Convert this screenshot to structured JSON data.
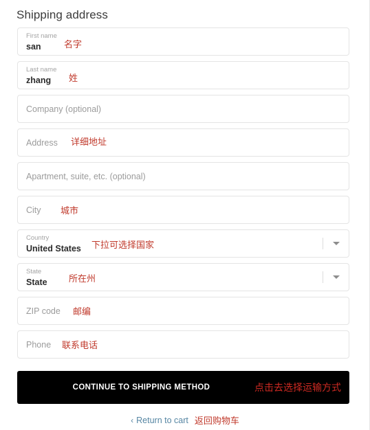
{
  "page": {
    "title": "Shipping address"
  },
  "colors": {
    "annotation_red": "#c0392b",
    "button_bg": "#000000",
    "link_blue": "#5686a3",
    "field_border": "#e4e4e4",
    "placeholder_gray": "#9b9b9b"
  },
  "form": {
    "fields": [
      {
        "name": "first-name",
        "label": "First name",
        "value": "san",
        "placeholder": "First name",
        "filled": true,
        "note": "名字",
        "type": "text"
      },
      {
        "name": "last-name",
        "label": "Last name",
        "value": "zhang",
        "placeholder": "Last name",
        "filled": true,
        "note": "姓",
        "type": "text"
      },
      {
        "name": "company",
        "label": "Company (optional)",
        "value": "",
        "placeholder": "Company (optional)",
        "filled": false,
        "note": "",
        "type": "text"
      },
      {
        "name": "address",
        "label": "Address",
        "value": "",
        "placeholder": "Address",
        "filled": false,
        "note": "详细地址",
        "type": "text"
      },
      {
        "name": "apartment",
        "label": "Apartment, suite, etc. (optional)",
        "value": "",
        "placeholder": "Apartment, suite, etc. (optional)",
        "filled": false,
        "note": "",
        "type": "text"
      },
      {
        "name": "city",
        "label": "City",
        "value": "",
        "placeholder": "City",
        "filled": false,
        "note": "城市",
        "type": "text"
      },
      {
        "name": "country",
        "label": "Country",
        "value": "United States",
        "placeholder": "Country",
        "filled": true,
        "note": "下拉可选择国家",
        "type": "select"
      },
      {
        "name": "state",
        "label": "State",
        "value": "State",
        "placeholder": "State",
        "filled": true,
        "note": "所在州",
        "type": "select"
      },
      {
        "name": "zip-code",
        "label": "ZIP code",
        "value": "",
        "placeholder": "ZIP code",
        "filled": false,
        "note": "邮编",
        "type": "text"
      },
      {
        "name": "phone",
        "label": "Phone",
        "value": "",
        "placeholder": "Phone",
        "filled": false,
        "note": "联系电话",
        "type": "tel"
      }
    ]
  },
  "submit": {
    "label": "Continue to shipping method",
    "note": "点击去选择运输方式"
  },
  "footer": {
    "chevron": "‹",
    "return_label": "Return to cart",
    "note": "返回购物车"
  }
}
